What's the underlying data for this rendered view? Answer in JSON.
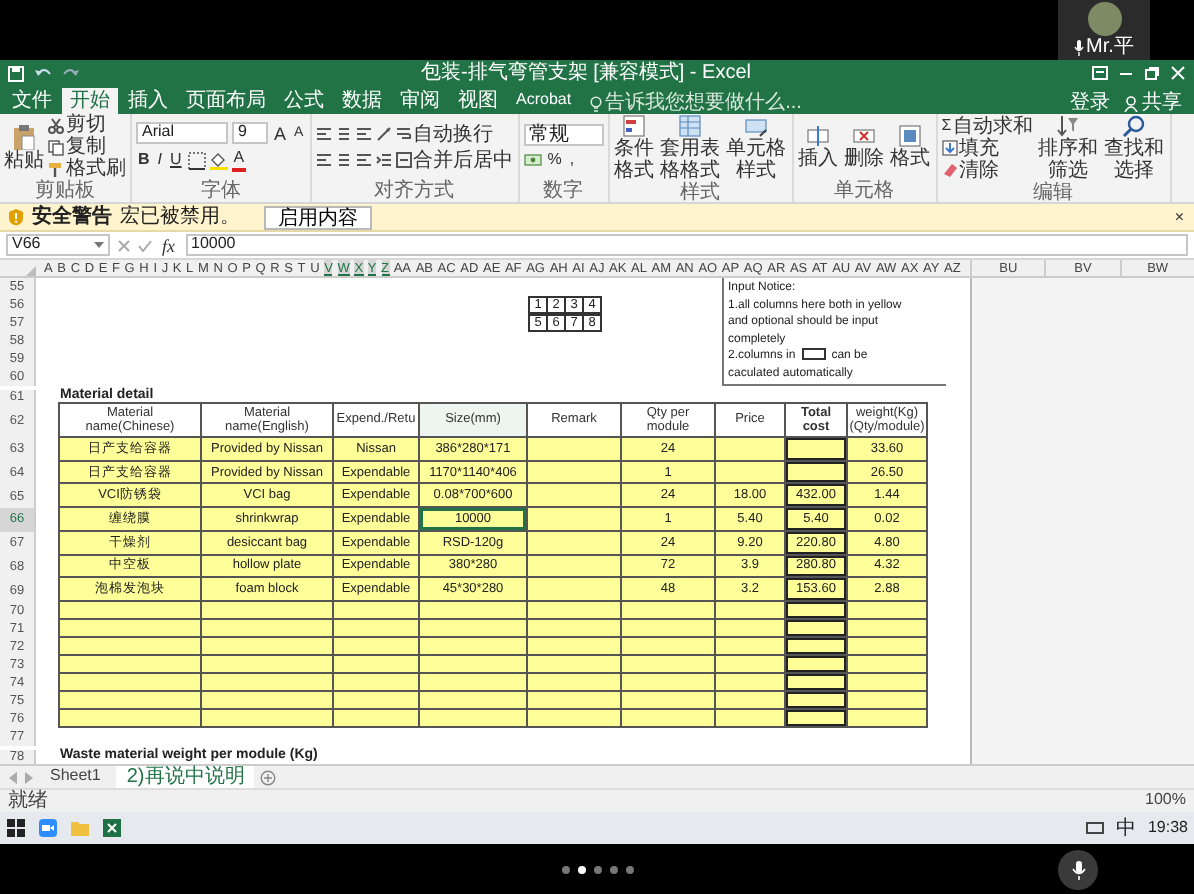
{
  "call": {
    "participant": {
      "name": "Mr.平"
    },
    "pager": [
      {
        "selected": false
      },
      {
        "selected": true
      },
      {
        "selected": false
      },
      {
        "selected": false
      },
      {
        "selected": false
      }
    ]
  },
  "excel": {
    "title": "包装-排气弯管支架 [兼容模式] - Excel",
    "tabs": [
      {
        "label": "文件",
        "selected": false
      },
      {
        "label": "开始",
        "selected": true
      },
      {
        "label": "插入",
        "selected": false
      },
      {
        "label": "页面布局",
        "selected": false
      },
      {
        "label": "公式",
        "selected": false
      },
      {
        "label": "数据",
        "selected": false
      },
      {
        "label": "审阅",
        "selected": false
      },
      {
        "label": "视图",
        "selected": false
      },
      {
        "label": "Acrobat",
        "selected": false
      }
    ],
    "tell_me": "告诉我您想要做什么...",
    "sign_in": "登录",
    "share": "共享",
    "ribbon": {
      "clipboard": {
        "label": "剪贴板",
        "paste": "粘贴",
        "items": [
          "剪切",
          "复制",
          "格式刷"
        ]
      },
      "font": {
        "label": "字体",
        "name": "Arial",
        "size": "9",
        "grow_buttons": [
          "A",
          "A"
        ],
        "style_buttons": [
          "B",
          "I",
          "U"
        ],
        "color_button": "A"
      },
      "alignment": {
        "label": "对齐方式",
        "wrap": "自动换行",
        "merge": "合并后居中"
      },
      "number": {
        "label": "数字",
        "format": "常规",
        "buttons": [
          "%",
          ","
        ]
      },
      "styles": {
        "label": "样式",
        "buttons": [
          "条件格式",
          "套用表格格式",
          "单元格样式"
        ]
      },
      "cells": {
        "label": "单元格",
        "buttons": [
          "插入",
          "删除",
          "格式"
        ]
      },
      "editing": {
        "label": "编辑",
        "sum_symbol": "Σ",
        "items": [
          "自动求和",
          "填充",
          "清除"
        ],
        "buttons": [
          "排序和筛选",
          "查找和选择"
        ]
      }
    },
    "security_bar": {
      "title": "安全警告",
      "message": "宏已被禁用。",
      "button": "启用内容",
      "close": "×"
    },
    "formula_bar": {
      "name_box": "V66",
      "fx": "fx",
      "value": "10000"
    },
    "columns": [
      {
        "label": "A",
        "selected": false
      },
      {
        "label": "B",
        "selected": false
      },
      {
        "label": "C",
        "selected": false
      },
      {
        "label": "D",
        "selected": false
      },
      {
        "label": "E",
        "selected": false
      },
      {
        "label": "F",
        "selected": false
      },
      {
        "label": "G",
        "selected": false
      },
      {
        "label": "H",
        "selected": false
      },
      {
        "label": "I",
        "selected": false
      },
      {
        "label": "J",
        "selected": false
      },
      {
        "label": "K",
        "selected": false
      },
      {
        "label": "L",
        "selected": false
      },
      {
        "label": "M",
        "selected": false
      },
      {
        "label": "N",
        "selected": false
      },
      {
        "label": "O",
        "selected": false
      },
      {
        "label": "P",
        "selected": false
      },
      {
        "label": "Q",
        "selected": false
      },
      {
        "label": "R",
        "selected": false
      },
      {
        "label": "S",
        "selected": false
      },
      {
        "label": "T",
        "selected": false
      },
      {
        "label": "U",
        "selected": false
      },
      {
        "label": "V",
        "selected": true
      },
      {
        "label": "W",
        "selected": true
      },
      {
        "label": "X",
        "selected": true
      },
      {
        "label": "Y",
        "selected": true
      },
      {
        "label": "Z",
        "selected": true
      },
      {
        "label": "AA",
        "selected": false
      },
      {
        "label": "AB",
        "selected": false
      },
      {
        "label": "AC",
        "selected": false
      },
      {
        "label": "AD",
        "selected": false
      },
      {
        "label": "AE",
        "selected": false
      },
      {
        "label": "AF",
        "selected": false
      },
      {
        "label": "AG",
        "selected": false
      },
      {
        "label": "AH",
        "selected": false
      },
      {
        "label": "AI",
        "selected": false
      },
      {
        "label": "AJ",
        "selected": false
      },
      {
        "label": "AK",
        "selected": false
      },
      {
        "label": "AL",
        "selected": false
      },
      {
        "label": "AM",
        "selected": false
      },
      {
        "label": "AN",
        "selected": false
      },
      {
        "label": "AO",
        "selected": false
      },
      {
        "label": "AP",
        "selected": false
      },
      {
        "label": "AQ",
        "selected": false
      },
      {
        "label": "AR",
        "selected": false
      },
      {
        "label": "AS",
        "selected": false
      },
      {
        "label": "AT",
        "selected": false
      },
      {
        "label": "AU",
        "selected": false
      },
      {
        "label": "AV",
        "selected": false
      },
      {
        "label": "AW",
        "selected": false
      },
      {
        "label": "AX",
        "selected": false
      },
      {
        "label": "AY",
        "selected": false
      },
      {
        "label": "AZ",
        "selected": false
      }
    ],
    "extra_columns": [
      "BU",
      "BV",
      "BW"
    ],
    "sheet": {
      "notice": [
        {
          "kind": "text",
          "text": "Input Notice:"
        },
        {
          "kind": "text",
          "text": "1.all columns here both in yellow"
        },
        {
          "kind": "text",
          "text": "and optional should be input"
        },
        {
          "kind": "text",
          "text": "completely"
        },
        {
          "kind": "boxed",
          "before": "2.columns in",
          "after": "can be"
        },
        {
          "kind": "text",
          "text": "caculated automatically"
        }
      ],
      "table_columns": [
        {
          "label": "Material name(Chinese)",
          "selected": false,
          "calculated": false
        },
        {
          "label": "Material name(English)",
          "selected": false,
          "calculated": false
        },
        {
          "label": "Expend./Retu",
          "selected": false,
          "calculated": false
        },
        {
          "label": "Size(mm)",
          "selected": true,
          "calculated": false
        },
        {
          "label": "Remark",
          "selected": false,
          "calculated": false
        },
        {
          "label": "Qty per module",
          "selected": false,
          "calculated": false
        },
        {
          "label": "Price",
          "selected": false,
          "calculated": false
        },
        {
          "label": "Total cost",
          "selected": false,
          "calculated": true
        },
        {
          "label": "weight(Kg) (Qty/module)",
          "selected": false,
          "calculated": false
        }
      ],
      "rows": [
        {
          "number": "55",
          "selected": false,
          "kind": "blank"
        },
        {
          "number": "56",
          "selected": false,
          "kind": "boxes",
          "cells": [
            "1",
            "2",
            "3",
            "4"
          ]
        },
        {
          "number": "57",
          "selected": false,
          "kind": "boxes",
          "cells": [
            "5",
            "6",
            "7",
            "8"
          ]
        },
        {
          "number": "58",
          "selected": false,
          "kind": "blank"
        },
        {
          "number": "59",
          "selected": false,
          "kind": "blank"
        },
        {
          "number": "60",
          "selected": false,
          "kind": "blank"
        },
        {
          "number": "61",
          "selected": false,
          "kind": "title",
          "text": "Material detail"
        },
        {
          "number": "62",
          "selected": false,
          "kind": "header"
        },
        {
          "number": "63",
          "selected": false,
          "kind": "item",
          "cells": [
            "日产支给容器",
            "Provided by Nissan",
            "Nissan",
            "386*280*171",
            null,
            "24",
            null,
            null,
            "33.60"
          ]
        },
        {
          "number": "64",
          "selected": false,
          "kind": "item",
          "cells": [
            "日产支给容器",
            "Provided by Nissan",
            "Expendable",
            "1170*1140*406",
            null,
            "1",
            null,
            null,
            "26.50"
          ]
        },
        {
          "number": "65",
          "selected": false,
          "kind": "item",
          "cells": [
            "VCI防锈袋",
            "VCI bag",
            "Expendable",
            "0.08*700*600",
            null,
            "24",
            "18.00",
            "432.00",
            "1.44"
          ]
        },
        {
          "number": "66",
          "selected": true,
          "kind": "item",
          "cells": [
            "缠绕膜",
            "shrinkwrap",
            "Expendable",
            "10000",
            null,
            "1",
            "5.40",
            "5.40",
            "0.02"
          ]
        },
        {
          "number": "67",
          "selected": false,
          "kind": "item",
          "cells": [
            "干燥剂",
            "desiccant bag",
            "Expendable",
            "RSD-120g",
            null,
            "24",
            "9.20",
            "220.80",
            "4.80"
          ]
        },
        {
          "number": "68",
          "selected": false,
          "kind": "item",
          "cells": [
            "中空板",
            "hollow plate",
            "Expendable",
            "380*280",
            null,
            "72",
            "3.9",
            "280.80",
            "4.32"
          ]
        },
        {
          "number": "69",
          "selected": false,
          "kind": "item",
          "cells": [
            "泡棉发泡块",
            "foam block",
            "Expendable",
            "45*30*280",
            null,
            "48",
            "3.2",
            "153.60",
            "2.88"
          ]
        },
        {
          "number": "70",
          "selected": false,
          "kind": "empty"
        },
        {
          "number": "71",
          "selected": false,
          "kind": "empty"
        },
        {
          "number": "72",
          "selected": false,
          "kind": "empty"
        },
        {
          "number": "73",
          "selected": false,
          "kind": "empty"
        },
        {
          "number": "74",
          "selected": false,
          "kind": "empty"
        },
        {
          "number": "75",
          "selected": false,
          "kind": "empty"
        },
        {
          "number": "76",
          "selected": false,
          "kind": "empty"
        },
        {
          "number": "77",
          "selected": false,
          "kind": "blank"
        },
        {
          "number": "78",
          "selected": false,
          "kind": "title",
          "text": "Waste material weight per module (Kg)"
        }
      ]
    },
    "sheet_tabs": [
      {
        "label": "Sheet1",
        "selected": false
      },
      {
        "label": "2)再说中说明",
        "selected": true
      }
    ],
    "status": "就绪",
    "zoom": "100%"
  },
  "taskbar": {
    "language": "中",
    "time": "19:38"
  }
}
